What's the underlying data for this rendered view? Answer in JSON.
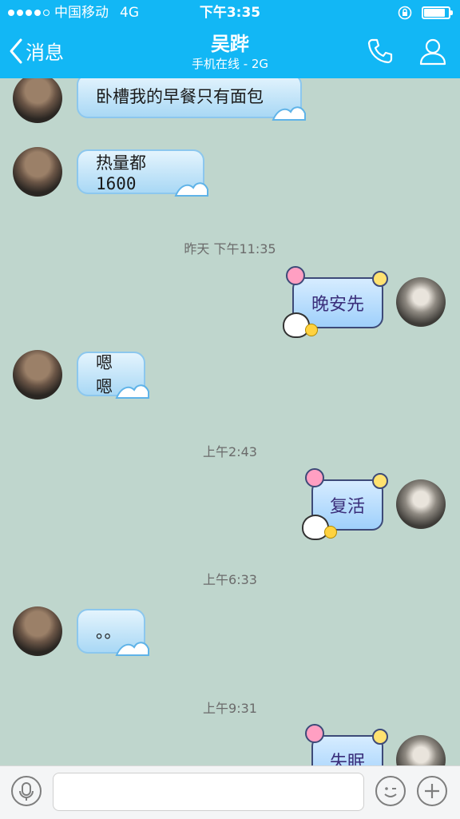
{
  "status_bar": {
    "carrier": "中国移动",
    "network": "4G",
    "time": "下午3:35",
    "battery_level": 0.85
  },
  "nav": {
    "back_label": "消息",
    "title": "吴跸",
    "subtitle": "手机在线 - 2G",
    "icons": [
      "phone-icon",
      "profile-icon"
    ]
  },
  "messages": [
    {
      "from": "them",
      "text": "卧槽我的早餐只有面包"
    },
    {
      "from": "them",
      "text": "热量都1600"
    },
    {
      "type": "timestamp",
      "text": "昨天 下午11:35"
    },
    {
      "from": "me",
      "text": "晚安先"
    },
    {
      "from": "them",
      "text": "嗯嗯"
    },
    {
      "type": "timestamp",
      "text": "上午2:43"
    },
    {
      "from": "me",
      "text": "复活"
    },
    {
      "type": "timestamp",
      "text": "上午6:33"
    },
    {
      "from": "them",
      "text": "。。"
    },
    {
      "type": "timestamp",
      "text": "上午9:31"
    },
    {
      "from": "me",
      "text": "失眠"
    }
  ],
  "input_bar": {
    "placeholder": "",
    "icons": [
      "microphone-icon",
      "emoji-icon",
      "plus-icon"
    ]
  },
  "colors": {
    "header": "#12b7f5",
    "chat_background": "#bfd6cd"
  }
}
